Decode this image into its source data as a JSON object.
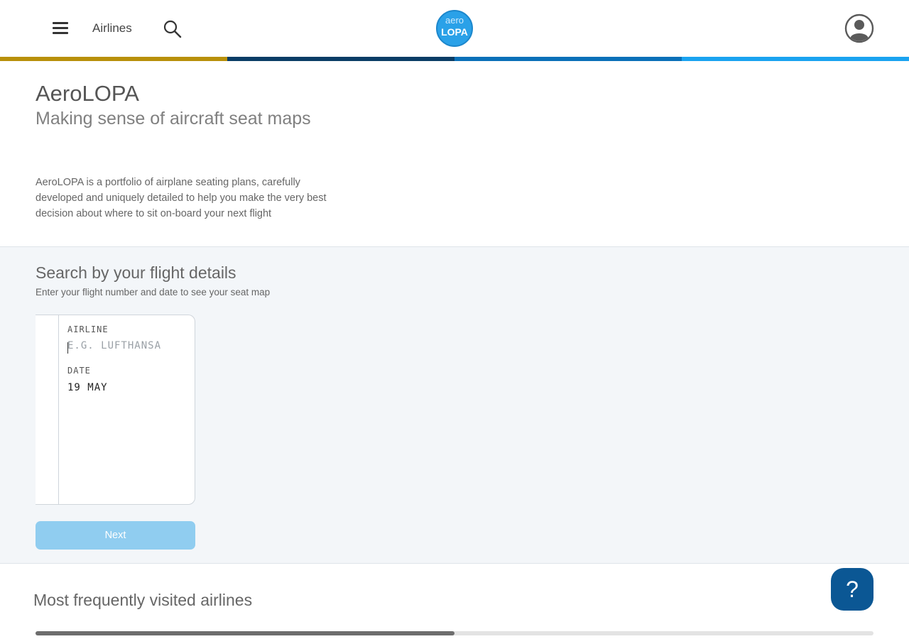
{
  "header": {
    "nav_airlines": "Airlines",
    "logo_top": "aero",
    "logo_bottom": "LOPA",
    "icons": {
      "menu": "hamburger-icon",
      "search": "search-icon",
      "account": "user-avatar-icon"
    },
    "stripe_colors": [
      "#b8900a",
      "#0a3d66",
      "#0a70b8",
      "#1aa3f0"
    ]
  },
  "hero": {
    "title": "AeroLOPA",
    "subtitle": "Making sense of aircraft seat maps",
    "description": "AeroLOPA is a portfolio of airplane seating plans, carefully developed and uniquely detailed to help you make the very best decision about where to sit on-board your next flight"
  },
  "search": {
    "title": "Search by your flight details",
    "hint": "Enter your flight number and date to see your seat map",
    "airline_label": "AIRLINE",
    "airline_value": "",
    "airline_placeholder": "E.G. LUFTHANSA",
    "date_label": "DATE",
    "date_value": "19 MAY",
    "next_label": "Next"
  },
  "frequent": {
    "title": "Most frequently visited airlines",
    "scroll_fraction": 0.5
  },
  "help": {
    "label": "?"
  },
  "colors": {
    "accent": "#0b5794",
    "button_disabled": "#90cdf0",
    "section_bg": "#f3f6f9"
  }
}
